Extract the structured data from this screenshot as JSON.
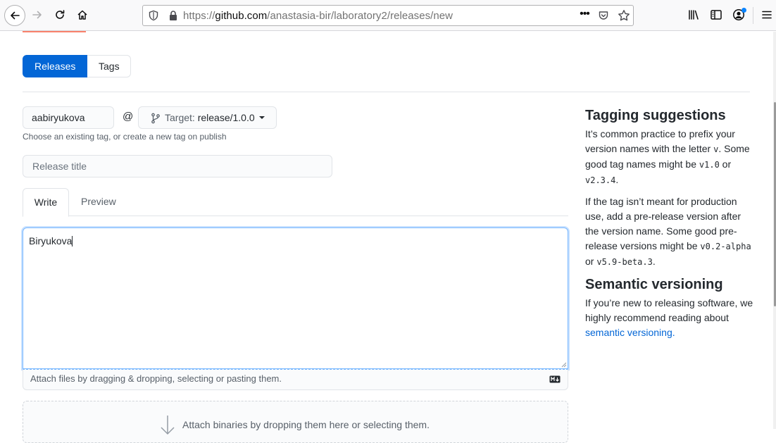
{
  "browser": {
    "url_prefix": "https://",
    "url_host": "github.com",
    "url_path": "/anastasia-bir/laboratory2/releases/new",
    "more_label": "•••"
  },
  "subnav": {
    "releases": "Releases",
    "tags": "Tags"
  },
  "form": {
    "tag_value": "aabiryukova",
    "at": "@",
    "target_label": "Target: ",
    "target_value": "release/1.0.0",
    "hint": "Choose an existing tag, or create a new tag on publish",
    "title_placeholder": "Release title",
    "tab_write": "Write",
    "tab_preview": "Preview",
    "body_text": "Biryukova",
    "attach_hint": "Attach files by dragging & dropping, selecting or pasting them.",
    "binaries_hint": "Attach binaries by dropping them here or selecting them."
  },
  "sidebar": {
    "tagging_title": "Tagging suggestions",
    "p1_a": "It’s common practice to prefix your version names with the letter ",
    "p1_code1": "v",
    "p1_b": ". Some good tag names might be ",
    "p1_code2": "v1.0",
    "p1_c": " or ",
    "p1_code3": "v2.3.4",
    "p1_d": ".",
    "p2_a": "If the tag isn’t meant for production use, add a pre-release version after the version name. Some good pre-release versions might be ",
    "p2_code1": "v0.2-alpha",
    "p2_b": " or ",
    "p2_code2": "v5.9-beta.3",
    "p2_c": ".",
    "semver_title": "Semantic versioning",
    "p3_a": "If you’re new to releasing software, we highly recommend reading about ",
    "p3_link": "semantic versioning."
  },
  "colors": {
    "accent": "#0366d6",
    "focus": "#79b8ff"
  }
}
